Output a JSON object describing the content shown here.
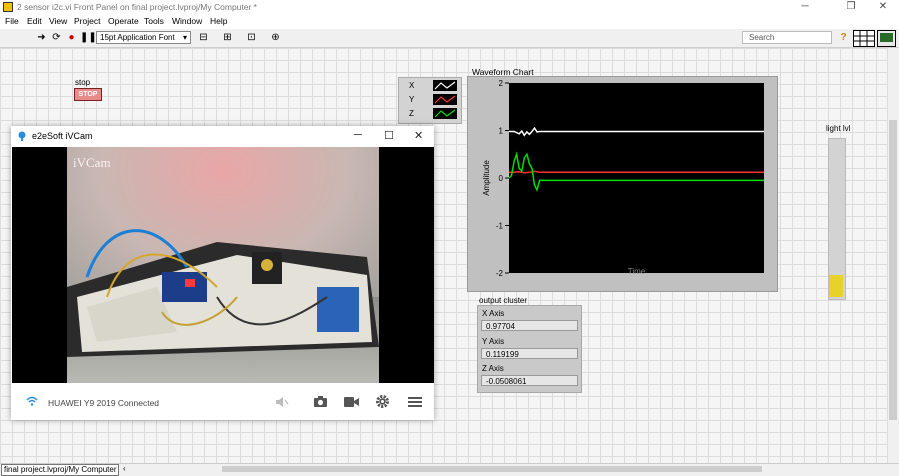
{
  "window": {
    "title": "2 sensor i2c.vi Front Panel on final project.lvproj/My Computer *",
    "minimize": "─",
    "maximize": "❐",
    "close": "✕"
  },
  "menu": [
    "File",
    "Edit",
    "View",
    "Project",
    "Operate",
    "Tools",
    "Window",
    "Help"
  ],
  "toolbar": {
    "font_label": "15pt Application Font",
    "search_placeholder": "Search",
    "help_glyph": "?"
  },
  "stop": {
    "label": "stop",
    "button_text": "STOP"
  },
  "legend": {
    "items": [
      {
        "name": "X",
        "color": "#ffffff"
      },
      {
        "name": "Y",
        "color": "#ff3030"
      },
      {
        "name": "Z",
        "color": "#00e000"
      }
    ]
  },
  "chart_data": {
    "type": "line",
    "title": "Waveform Chart",
    "ylabel": "Amplitude",
    "xlabel": "Time",
    "ylim": [
      -2,
      2
    ],
    "yticks": [
      "2",
      "1",
      "0",
      "-1",
      "-2"
    ],
    "grid": false,
    "series": [
      {
        "name": "X",
        "color": "#ffffff",
        "x": [
          0,
          2,
          4,
          5,
          6,
          7,
          8,
          9,
          10,
          11,
          12,
          15,
          20,
          40,
          100
        ],
        "y": [
          0.98,
          0.98,
          0.93,
          0.99,
          0.9,
          0.97,
          0.92,
          0.98,
          1.05,
          0.97,
          0.98,
          0.98,
          0.98,
          0.98,
          0.98
        ]
      },
      {
        "name": "Y",
        "color": "#ff3030",
        "x": [
          0,
          2,
          4,
          6,
          8,
          10,
          12,
          15,
          20,
          40,
          100
        ],
        "y": [
          0.12,
          0.12,
          0.13,
          0.11,
          0.12,
          0.14,
          0.12,
          0.12,
          0.12,
          0.12,
          0.12
        ]
      },
      {
        "name": "Z",
        "color": "#00e000",
        "x": [
          0,
          1,
          2,
          3,
          4,
          5,
          6,
          7,
          8,
          9,
          10,
          11,
          12,
          15,
          20,
          40,
          100
        ],
        "y": [
          0.0,
          0.05,
          0.35,
          0.5,
          0.2,
          0.15,
          0.42,
          0.5,
          0.3,
          0.2,
          -0.15,
          -0.25,
          -0.05,
          -0.05,
          -0.05,
          -0.05,
          -0.05
        ]
      }
    ]
  },
  "light": {
    "label": "light lvl",
    "level": 0.14,
    "fill_color": "#e8d22a"
  },
  "cluster": {
    "label": "output cluster",
    "items": [
      {
        "name": "X Axis",
        "value": "0.97704"
      },
      {
        "name": "Y Axis",
        "value": "0.119199"
      },
      {
        "name": "Z Axis",
        "value": "-0.0508061"
      }
    ]
  },
  "ivcam": {
    "title": "e2eSoft iVCam",
    "watermark": "iVCam",
    "status": "HUAWEI Y9 2019 Connected",
    "minimize": "─",
    "maximize": "☐",
    "close": "✕"
  },
  "statusbar": {
    "path": "final project.lvproj/My Computer"
  }
}
